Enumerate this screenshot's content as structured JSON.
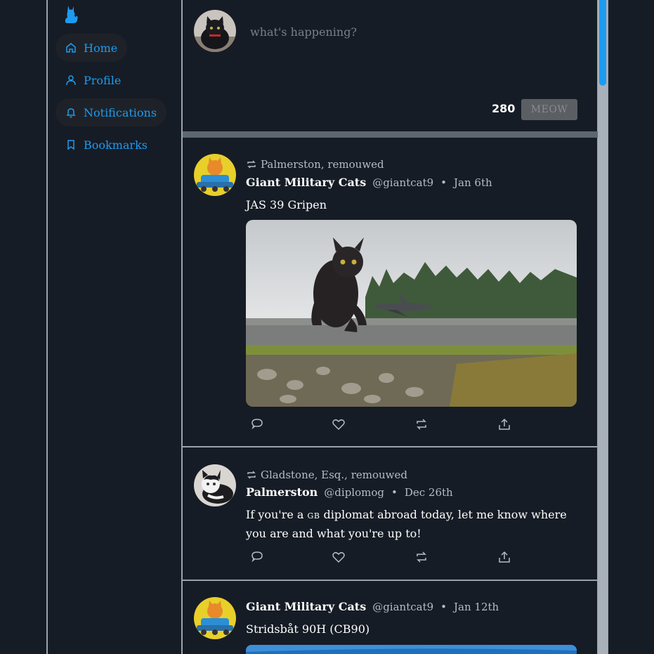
{
  "nav": {
    "items": [
      {
        "label": "Home",
        "icon": "home-icon"
      },
      {
        "label": "Profile",
        "icon": "user-icon"
      },
      {
        "label": "Notifications",
        "icon": "bell-icon"
      },
      {
        "label": "Bookmarks",
        "icon": "bookmark-icon"
      }
    ]
  },
  "composer": {
    "placeholder": "what's happening?",
    "counter": "280",
    "submit_label": "MEOW"
  },
  "tweets": [
    {
      "retweet_by": "Palmerston, remouwed",
      "name": "Giant Military Cats",
      "handle": "@giantcat9",
      "dot": "•",
      "date": "Jan 6th",
      "text": "JAS 39 Gripen"
    },
    {
      "retweet_by": "Gladstone, Esq., remouwed",
      "name": "Palmerston",
      "handle": "@diplomog",
      "dot": "•",
      "date": "Dec 26th",
      "text_before": "If you're a ",
      "text_sc": "GB",
      "text_after": " diplomat abroad today, let me know where you are and what you're up to!"
    },
    {
      "name": "Giant Military Cats",
      "handle": "@giantcat9",
      "dot": "•",
      "date": "Jan 12th",
      "text": "Stridsbåt 90H (CB90)"
    }
  ],
  "colors": {
    "background": "#161c25",
    "accent": "#1d9bf0",
    "divider": "#9aa3ad",
    "muted_text": "#b6bcc3"
  }
}
